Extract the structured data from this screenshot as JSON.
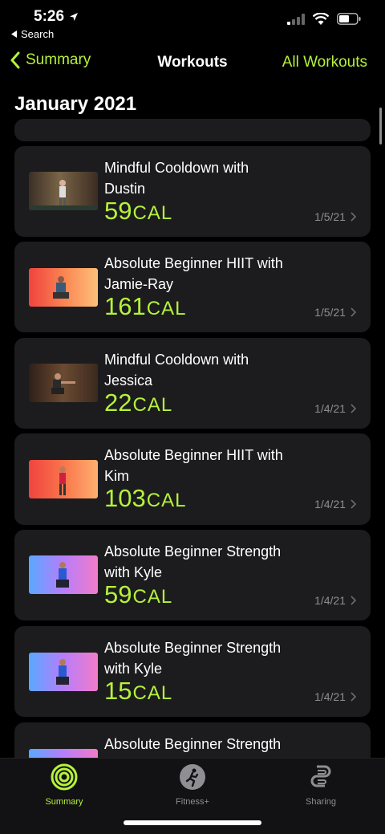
{
  "status_bar": {
    "time": "5:26",
    "back_app_label": "Search"
  },
  "nav": {
    "back_label": "Summary",
    "title": "Workouts",
    "right_label": "All Workouts"
  },
  "section": {
    "title": "January 2021"
  },
  "workouts": [
    {
      "title": "Mindful Cooldown with Dustin",
      "calories": "59",
      "unit": "CAL",
      "date": "1/5/21"
    },
    {
      "title": "Absolute Beginner HIIT with Jamie-Ray",
      "calories": "161",
      "unit": "CAL",
      "date": "1/5/21"
    },
    {
      "title": "Mindful Cooldown with Jessica",
      "calories": "22",
      "unit": "CAL",
      "date": "1/4/21"
    },
    {
      "title": "Absolute Beginner HIIT with Kim",
      "calories": "103",
      "unit": "CAL",
      "date": "1/4/21"
    },
    {
      "title": "Absolute Beginner Strength with Kyle",
      "calories": "59",
      "unit": "CAL",
      "date": "1/4/21"
    },
    {
      "title": "Absolute Beginner Strength with Kyle",
      "calories": "15",
      "unit": "CAL",
      "date": "1/4/21"
    },
    {
      "title": "Absolute Beginner Strength",
      "calories": "",
      "unit": "",
      "date": ""
    }
  ],
  "tabs": [
    {
      "label": "Summary",
      "icon": "activity-rings-icon",
      "color": "#b6f23a"
    },
    {
      "label": "Fitness+",
      "icon": "runner-icon",
      "color": "#8e8e93"
    },
    {
      "label": "Sharing",
      "icon": "sharing-icon",
      "color": "#8e8e93"
    }
  ],
  "colors": {
    "accent": "#b6f23a",
    "card_bg": "#1c1c1e",
    "secondary_text": "#8e8e93"
  }
}
